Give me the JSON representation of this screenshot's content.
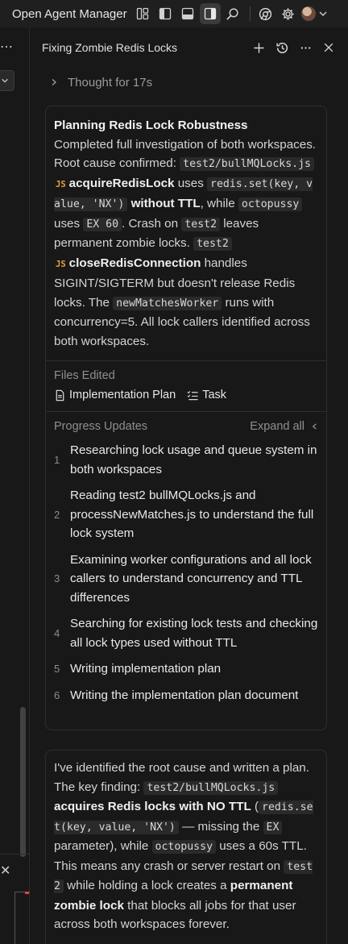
{
  "app": {
    "title": "Open Agent Manager"
  },
  "panel": {
    "title": "Fixing Zombie Redis Locks"
  },
  "thought": {
    "label": "Thought for 17s"
  },
  "summary": {
    "heading": "Planning Redis Lock Robustness",
    "t1": "Completed full investigation of both workspaces. Root cause confirmed: ",
    "c1": "test2/bullMQLocks.js",
    "js1": "JS",
    "n1": "acquireRedisLock",
    "t2": " uses ",
    "c2": "redis.set(key, value, 'NX')",
    "b1": "without TTL",
    "t3": ", while ",
    "c3": "octopussy",
    "t4": " uses ",
    "c4": "EX 60",
    "t5": ". Crash on ",
    "c5": "test2",
    "t6": " leaves permanent zombie locks. ",
    "c6": "test2",
    "js2": "JS",
    "n2": "closeRedisConnection",
    "t7": " handles SIGINT/SIGTERM but doesn't release Redis locks. The ",
    "c7": "newMatchesWorker",
    "t8": " runs with concurrency=5. All lock callers identified across both workspaces."
  },
  "files": {
    "label": "Files Edited",
    "items": [
      {
        "label": "Implementation Plan",
        "icon": "document-icon"
      },
      {
        "label": "Task",
        "icon": "checklist-icon"
      }
    ]
  },
  "progress": {
    "label": "Progress Updates",
    "expand_label": "Expand all",
    "steps": [
      {
        "num": "1",
        "text": "Researching lock usage and queue system in both workspaces"
      },
      {
        "num": "2",
        "text": "Reading test2 bullMQLocks.js and processNewMatches.js to understand the full lock system"
      },
      {
        "num": "3",
        "text": "Examining worker configurations and all lock callers to understand concurrency and TTL differences"
      },
      {
        "num": "4",
        "text": "Searching for existing lock tests and checking all lock types used without TTL"
      },
      {
        "num": "5",
        "text": "Writing implementation plan"
      },
      {
        "num": "6",
        "text": "Writing the implementation plan document"
      }
    ]
  },
  "message": {
    "t1": "I've identified the root cause and written a plan. The key finding: ",
    "c1": "test2/bullMQLocks.js",
    "b1": " acquires Redis locks with NO TTL",
    "t2": " (",
    "c2": "redis.set(key, value, 'NX')",
    "t3": " — missing the ",
    "c3": "EX",
    "t4": " parameter), while ",
    "c4": "octopussy",
    "t5": " uses a 60s TTL. This means any crash or server restart on ",
    "c5": "test2",
    "t6": " while holding a lock creates a ",
    "b2": "permanent zombie lock",
    "t7": " that blocks all jobs for that user across both workspaces forever."
  },
  "colors": {
    "background": "#181818",
    "card_border": "#2e2e2e",
    "js_badge": "#e8a03a",
    "code_bg": "#2a2a2a"
  }
}
